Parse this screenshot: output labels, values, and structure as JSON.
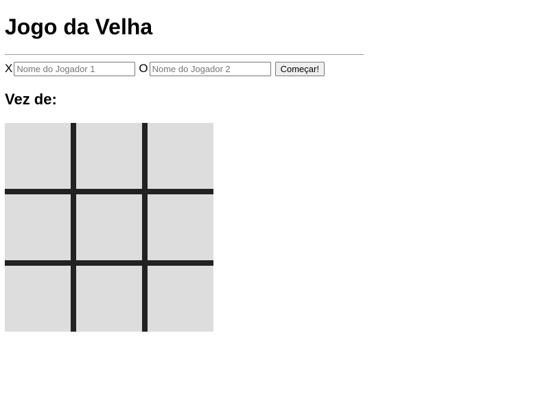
{
  "header": {
    "title": "Jogo da Velha"
  },
  "players": {
    "x": {
      "symbol": "X",
      "placeholder": "Nome do Jogador 1",
      "value": ""
    },
    "o": {
      "symbol": "O",
      "placeholder": "Nome do Jogador 2",
      "value": ""
    },
    "start_label": "Começar!"
  },
  "turn": {
    "label": "Vez de:",
    "current_player": ""
  },
  "board": {
    "cells": [
      "",
      "",
      "",
      "",
      "",
      "",
      "",
      "",
      ""
    ]
  },
  "colors": {
    "cell_background": "#dddddd",
    "grid_lines": "#222222"
  }
}
